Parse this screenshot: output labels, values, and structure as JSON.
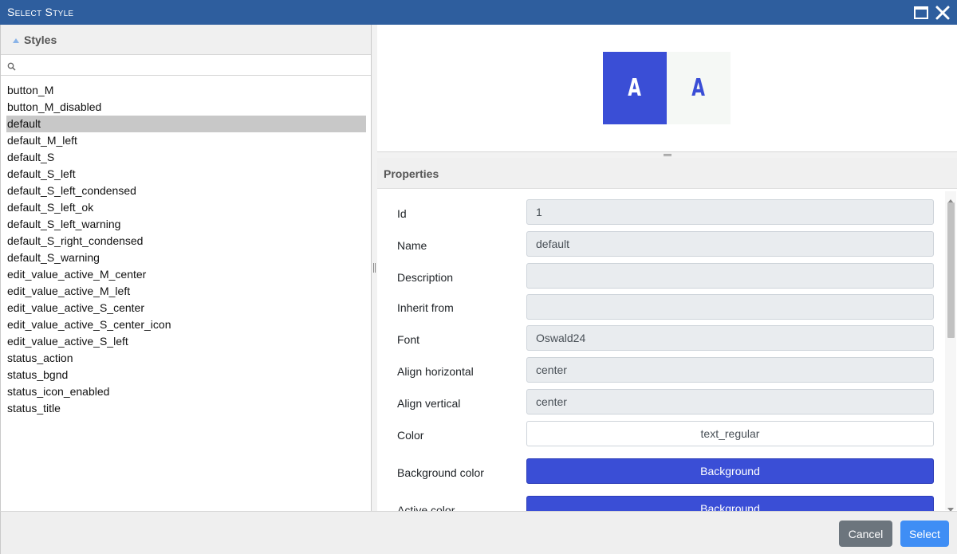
{
  "window": {
    "title": "Select Style",
    "maximize_icon": "maximize-icon",
    "close_icon": "close-icon"
  },
  "styles_panel": {
    "header": "Styles",
    "sort_icon": "sort-ascending-icon",
    "search": {
      "value": "",
      "placeholder": ""
    },
    "items": [
      "button_M",
      "button_M_disabled",
      "default",
      "default_M_left",
      "default_S",
      "default_S_left",
      "default_S_left_condensed",
      "default_S_left_ok",
      "default_S_left_warning",
      "default_S_right_condensed",
      "default_S_warning",
      "edit_value_active_M_center",
      "edit_value_active_M_left",
      "edit_value_active_S_center",
      "edit_value_active_S_center_icon",
      "edit_value_active_S_left",
      "status_action",
      "status_bgnd",
      "status_icon_enabled",
      "status_title"
    ],
    "selected": "default"
  },
  "preview": {
    "active_glyph": "A",
    "normal_glyph": "A",
    "active_bg": "#3a4ed6",
    "active_fg": "#ffffff",
    "normal_bg": "#f5f8f5",
    "normal_fg": "#3a4ed6"
  },
  "properties": {
    "header": "Properties",
    "id": {
      "label": "Id",
      "value": "1"
    },
    "name": {
      "label": "Name",
      "value": "default"
    },
    "description": {
      "label": "Description",
      "value": ""
    },
    "inherit_from": {
      "label": "Inherit from",
      "value": ""
    },
    "font": {
      "label": "Font",
      "value": "Oswald24"
    },
    "align_horizontal": {
      "label": "Align horizontal",
      "value": "center"
    },
    "align_vertical": {
      "label": "Align vertical",
      "value": "center"
    },
    "color": {
      "label": "Color",
      "value": "text_regular"
    },
    "background_color": {
      "label": "Background color",
      "value": "Background"
    },
    "active_color": {
      "label": "Active color",
      "value": "Background"
    }
  },
  "footer": {
    "cancel_label": "Cancel",
    "select_label": "Select"
  },
  "colors": {
    "titlebar": "#2e5e9e",
    "accent_blue": "#3a4ed6",
    "select_button": "#3f8ef5",
    "cancel_button": "#6c757d",
    "selection_bg": "#c8c8c8"
  }
}
